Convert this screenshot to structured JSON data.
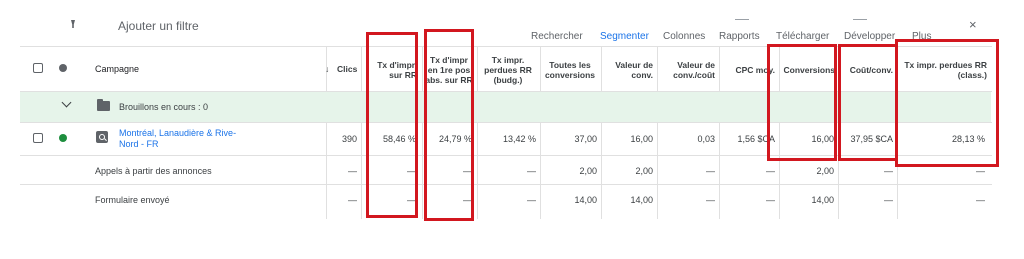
{
  "toolbar": {
    "add_filter": "Ajouter un filtre",
    "search": "Rechercher",
    "segment": "Segmenter",
    "columns": "Colonnes",
    "reports": "Rapports",
    "download": "Télécharger",
    "expand": "Développer",
    "more": "Plus",
    "close": "×"
  },
  "table": {
    "headers": {
      "campaign": "Campagne",
      "clicks": "Clics",
      "sort_arrow": "↓",
      "impr_share_rank": [
        "Tx d'impr.",
        "sur RR"
      ],
      "abs_top": [
        "Tx d'impr",
        "en 1re pos",
        "abs. sur RR"
      ],
      "lost_budget": [
        "Tx impr.",
        "perdues RR",
        "(budg.)"
      ],
      "all_conv": [
        "Toutes les",
        "conversions"
      ],
      "conv_value": [
        "Valeur de",
        "conv."
      ],
      "value_cost": [
        "Valeur de",
        "conv./coût"
      ],
      "cpc": "CPC moy.",
      "conversions": "Conversions",
      "cost_conv": "Coût/conv.",
      "lost_rank": [
        "Tx impr. perdues RR",
        "(class.)"
      ]
    },
    "draft_row": "Brouillons en cours : 0",
    "campaign_row": {
      "name": [
        "Montréal, Lanaudière & Rive-",
        "Nord - FR"
      ],
      "clicks": "390",
      "impr_share_rank": "58,46 %",
      "abs_top": "24,79 %",
      "lost_budget": "13,42 %",
      "all_conv": "37,00",
      "conv_value": "16,00",
      "value_cost": "0,03",
      "cpc": "1,56 $CA",
      "conversions": "16,00",
      "cost_conv": "37,95 $CA",
      "lost_rank": "28,13 %"
    },
    "sub_rows": [
      {
        "label": "Appels à partir des annonces",
        "clicks": "—",
        "impr_share_rank": "—",
        "abs_top": "—",
        "lost_budget": "—",
        "all_conv": "2,00",
        "conv_value": "2,00",
        "value_cost": "—",
        "cpc": "—",
        "conversions": "2,00",
        "cost_conv": "—",
        "lost_rank": "—"
      },
      {
        "label": "Formulaire envoyé",
        "clicks": "—",
        "impr_share_rank": "—",
        "abs_top": "—",
        "lost_budget": "—",
        "all_conv": "14,00",
        "conv_value": "14,00",
        "value_cost": "—",
        "cpc": "—",
        "conversions": "14,00",
        "cost_conv": "—",
        "lost_rank": "—"
      }
    ]
  },
  "colors": {
    "highlight": "#d2171f",
    "draft_bg": "#e6f4ea",
    "link": "#1a73e8",
    "status_green": "#1e8e3e"
  }
}
